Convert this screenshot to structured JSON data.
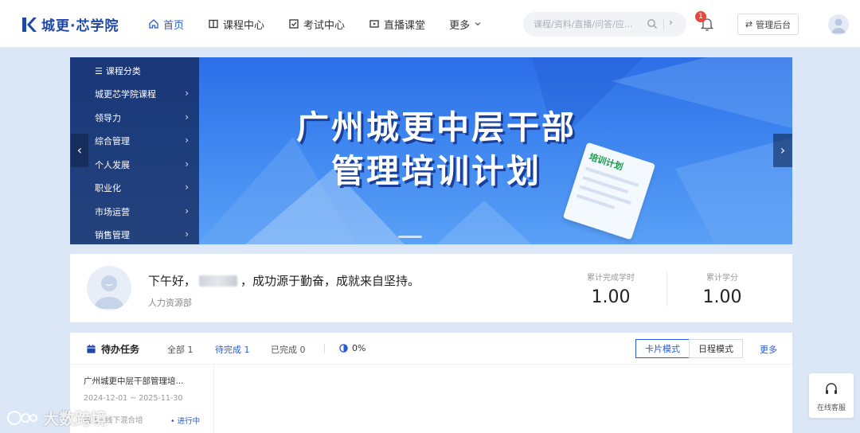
{
  "header": {
    "logo_text": "城更·芯学院",
    "nav": [
      {
        "label": "首页",
        "icon": "home-icon",
        "active": true
      },
      {
        "label": "课程中心",
        "icon": "book-icon",
        "active": false
      },
      {
        "label": "考试中心",
        "icon": "exam-icon",
        "active": false
      },
      {
        "label": "直播课堂",
        "icon": "live-icon",
        "active": false
      },
      {
        "label": "更多",
        "icon": "chevron-down-icon",
        "active": false
      }
    ],
    "search_placeholder": "课程/资料/直播/问答/应...",
    "notification_count": "1",
    "admin_label": "管理后台"
  },
  "banner": {
    "title_line1": "广州城更中层干部",
    "title_line2": "管理培训计划",
    "tag": "培训计划",
    "category_head": "课程分类",
    "categories": [
      "城更芯学院课程",
      "领导力",
      "综合管理",
      "个人发展",
      "职业化",
      "市场运营",
      "销售管理"
    ]
  },
  "welcome": {
    "greeting_prefix": "下午好，",
    "greeting_suffix": "，成功源于勤奋，成就来自坚持。",
    "department": "人力资源部",
    "stats": [
      {
        "label": "累计完成学时",
        "value": "1.00"
      },
      {
        "label": "累计学分",
        "value": "1.00"
      }
    ]
  },
  "todo": {
    "title": "待办任务",
    "tabs": [
      {
        "label": "全部 1",
        "active": false
      },
      {
        "label": "待完成 1",
        "active": true
      },
      {
        "label": "已完成 0",
        "active": false
      }
    ],
    "progress": "0%",
    "modes": [
      {
        "label": "卡片模式",
        "active": true
      },
      {
        "label": "日程模式",
        "active": false
      }
    ],
    "more": "更多",
    "tasks": [
      {
        "name": "广州城更中层干部管理培...",
        "date": "2024-12-01 ~ 2025-11-30",
        "type": "线上+线下混合培",
        "status": "• 进行中"
      }
    ]
  },
  "service": {
    "label": "在线客服"
  },
  "watermark": "大数跨境",
  "colors": {
    "accent": "#2a5bd7",
    "brand": "#1f47a8",
    "badge": "#e5483f",
    "page_bg": "#dbe6f7"
  }
}
